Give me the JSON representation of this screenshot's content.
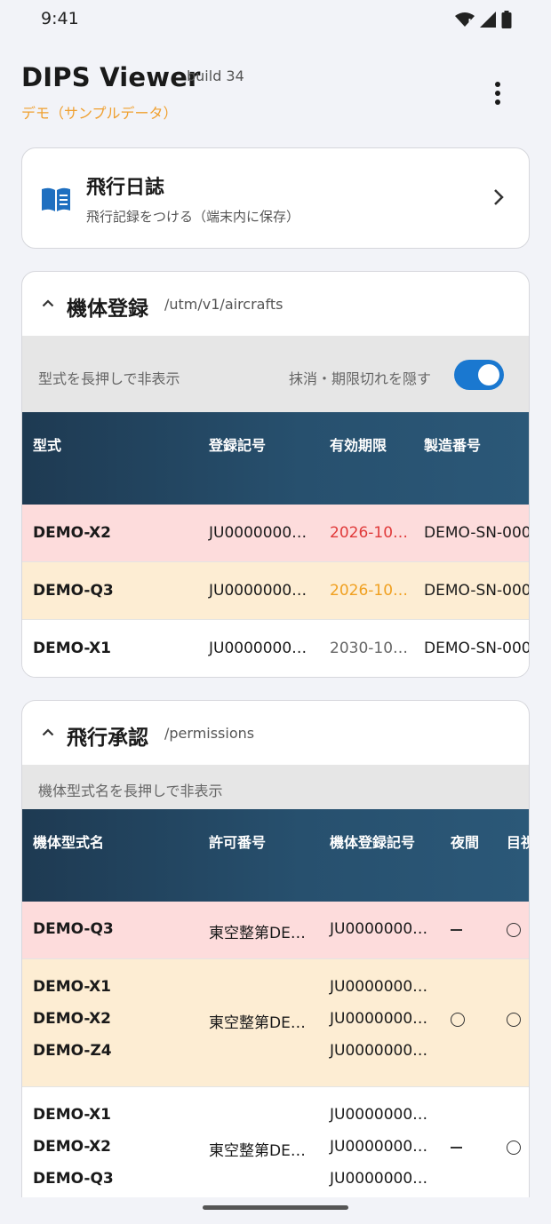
{
  "status_bar": {
    "time": "9:41",
    "icons": [
      "wifi-icon",
      "signal-icon",
      "battery-icon"
    ]
  },
  "header": {
    "title": "DIPS Viewer",
    "build": "build 34",
    "subtitle": "デモ（サンプルデータ）",
    "menu_icon": "more-vert-icon"
  },
  "flight_log_card": {
    "icon": "book-icon",
    "title": "飛行日誌",
    "description": "飛行記録をつける（端末内に保存）",
    "chevron_icon": "chevron-right-icon"
  },
  "aircraft_section": {
    "title": "機体登録",
    "path": "/utm/v1/aircrafts",
    "toolbar_hint": "型式を長押しで非表示",
    "toggle_label": "抹消・期限切れを隠す",
    "toggle_on": true,
    "columns": [
      "型式",
      "登録記号",
      "有効期限",
      "製造番号"
    ],
    "rows": [
      {
        "model": "DEMO-X2",
        "reg": "JU0000000…",
        "expiry": "2026-10…",
        "serial": "DEMO-SN-000",
        "bg": "#fddcdc",
        "expiry_color": "#e03a3a"
      },
      {
        "model": "DEMO-Q3",
        "reg": "JU0000000…",
        "expiry": "2026-10…",
        "serial": "DEMO-SN-000",
        "bg": "#fdedd3",
        "expiry_color": "#f0a020"
      },
      {
        "model": "DEMO-X1",
        "reg": "JU0000000…",
        "expiry": "2030-10…",
        "serial": "DEMO-SN-000",
        "bg": "#ffffff",
        "expiry_color": "#666666"
      }
    ]
  },
  "permission_section": {
    "title": "飛行承認",
    "path": "/permissions",
    "toolbar_hint": "機体型式名を長押しで非表示",
    "columns": [
      "機体型式名",
      "許可番号",
      "機体登録記号",
      "夜間",
      "目視"
    ],
    "rows": [
      {
        "models": [
          "DEMO-Q3"
        ],
        "permit": "東空整第DE…",
        "regs": [
          "JU0000000…"
        ],
        "night": "—",
        "visual": "○",
        "bg": "#fddcdc"
      },
      {
        "models": [
          "DEMO-X1",
          "DEMO-X2",
          "DEMO-Z4"
        ],
        "permit": "東空整第DE…",
        "regs": [
          "JU0000000…",
          "JU0000000…",
          "JU0000000…"
        ],
        "night": "○",
        "visual": "○",
        "bg": "#fdedd3"
      },
      {
        "models": [
          "DEMO-X1",
          "DEMO-X2",
          "DEMO-Q3"
        ],
        "permit": "東空整第DE…",
        "regs": [
          "JU0000000…",
          "JU0000000…",
          "JU0000000…"
        ],
        "night": "—",
        "visual": "○",
        "bg": "#ffffff"
      }
    ]
  },
  "colors": {
    "accent": "#1a78d0",
    "subtitle": "#f0a030",
    "table_header": "#27506e"
  }
}
